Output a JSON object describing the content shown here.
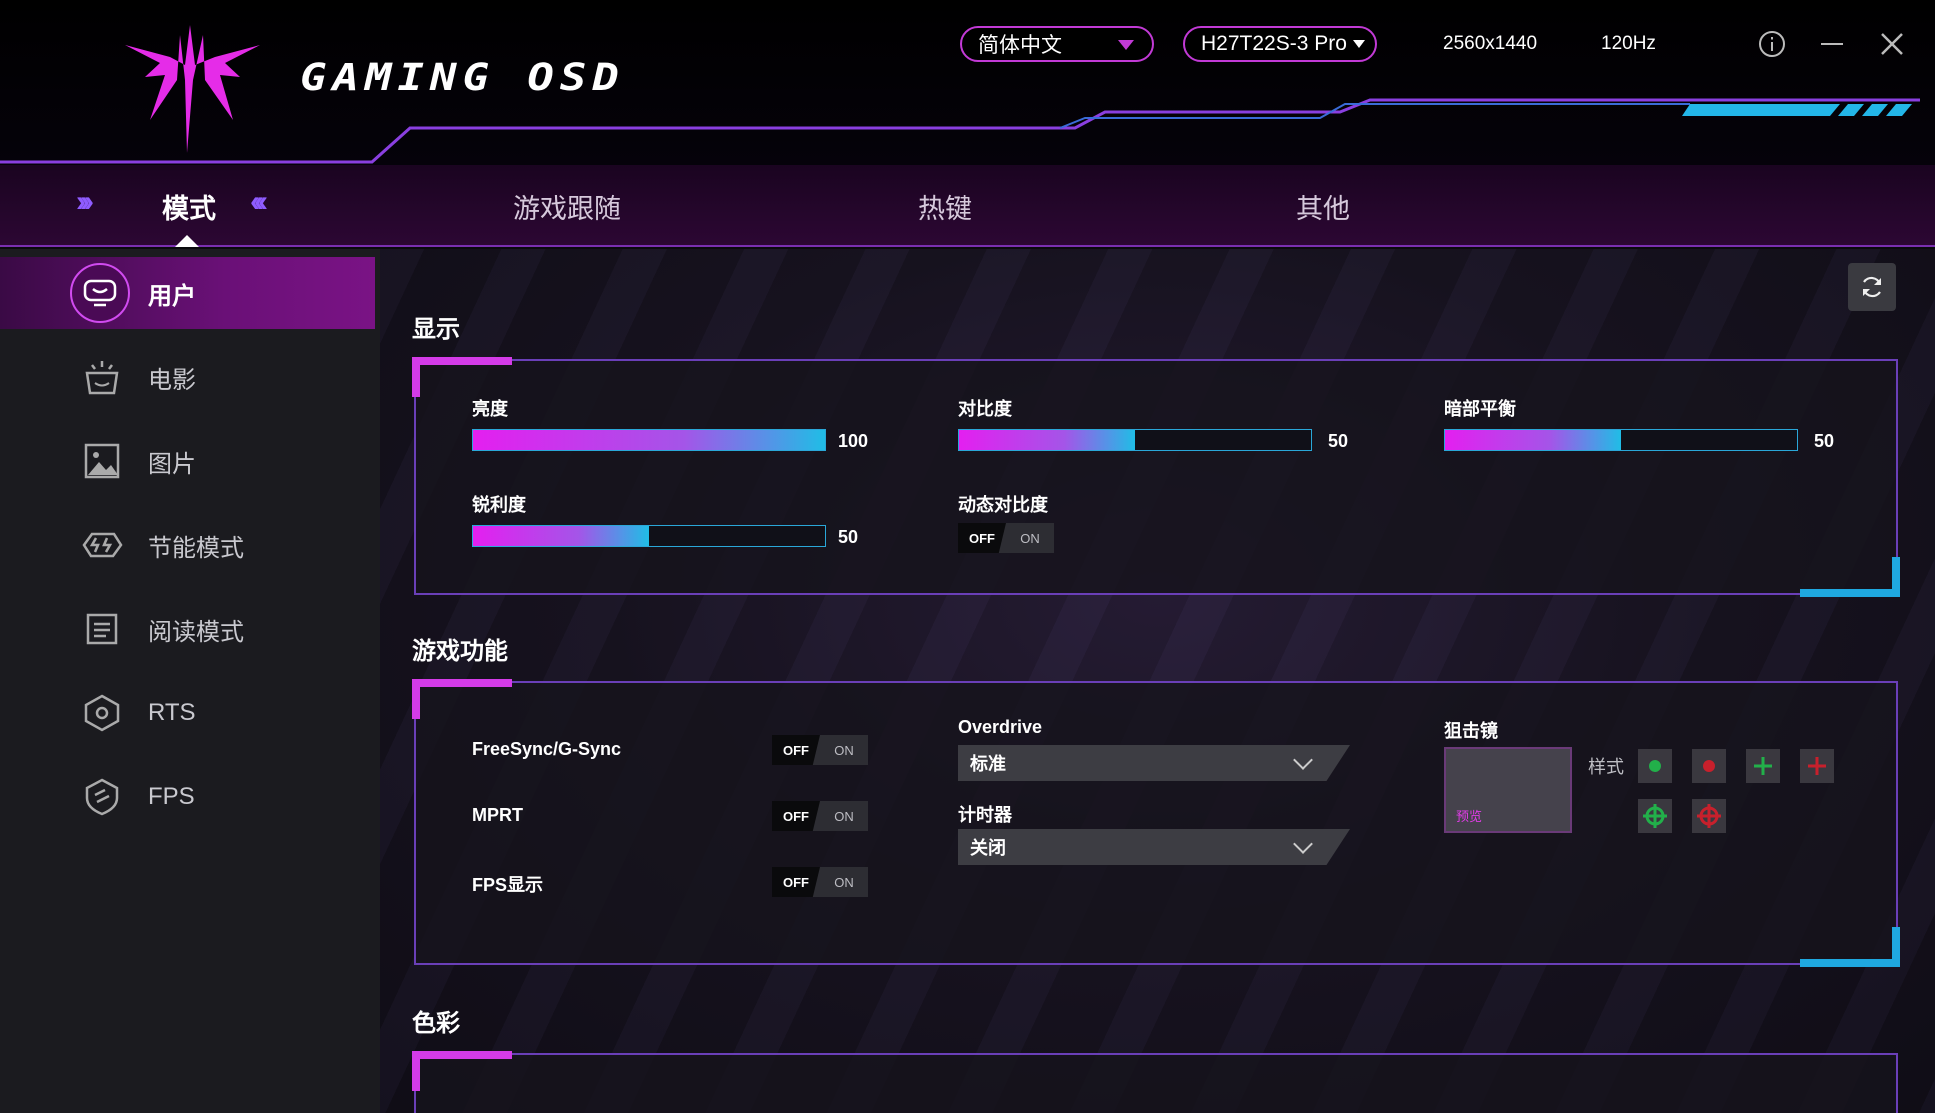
{
  "header": {
    "brand": "GAMING OSD",
    "language": "简体中文",
    "model": "H27T22S-3 Pro",
    "resolution": "2560x1440",
    "refresh_rate": "120Hz"
  },
  "nav": {
    "tabs": [
      {
        "label": "模式"
      },
      {
        "label": "游戏跟随"
      },
      {
        "label": "热键"
      },
      {
        "label": "其他"
      }
    ],
    "arrows_left": "›››",
    "arrows_right": "‹‹‹"
  },
  "sidebar": {
    "items": [
      {
        "label": "用户",
        "icon": "monitor-smile-icon"
      },
      {
        "label": "电影",
        "icon": "popcorn-icon"
      },
      {
        "label": "图片",
        "icon": "picture-icon"
      },
      {
        "label": "节能模式",
        "icon": "eco-icon"
      },
      {
        "label": "阅读模式",
        "icon": "book-icon"
      },
      {
        "label": "RTS",
        "icon": "hexagon-icon"
      },
      {
        "label": "FPS",
        "icon": "crosshair-shield-icon"
      }
    ]
  },
  "display": {
    "title": "显示",
    "brightness": {
      "label": "亮度",
      "value": 100
    },
    "contrast": {
      "label": "对比度",
      "value": 50
    },
    "dark_balance": {
      "label": "暗部平衡",
      "value": 50
    },
    "sharpness": {
      "label": "锐利度",
      "value": 50
    },
    "dynamic_contrast": {
      "label": "动态对比度",
      "off": "OFF",
      "on": "ON"
    }
  },
  "game": {
    "title": "游戏功能",
    "freesync": {
      "label": "FreeSync/G-Sync",
      "off": "OFF",
      "on": "ON"
    },
    "mprt": {
      "label": "MPRT",
      "off": "OFF",
      "on": "ON"
    },
    "fps_display": {
      "label": "FPS显示",
      "off": "OFF",
      "on": "ON"
    },
    "overdrive": {
      "label": "Overdrive",
      "value": "标准"
    },
    "timer": {
      "label": "计时器",
      "value": "关闭"
    },
    "crosshair": {
      "label": "狙击镜",
      "preview": "预览",
      "style_label": "样式"
    }
  },
  "color": {
    "title": "色彩"
  },
  "colors": {
    "accent_magenta": "#d43be8",
    "accent_blue": "#1fa8e0",
    "crosshair_green": "#22b04a",
    "crosshair_red": "#c8202c"
  }
}
